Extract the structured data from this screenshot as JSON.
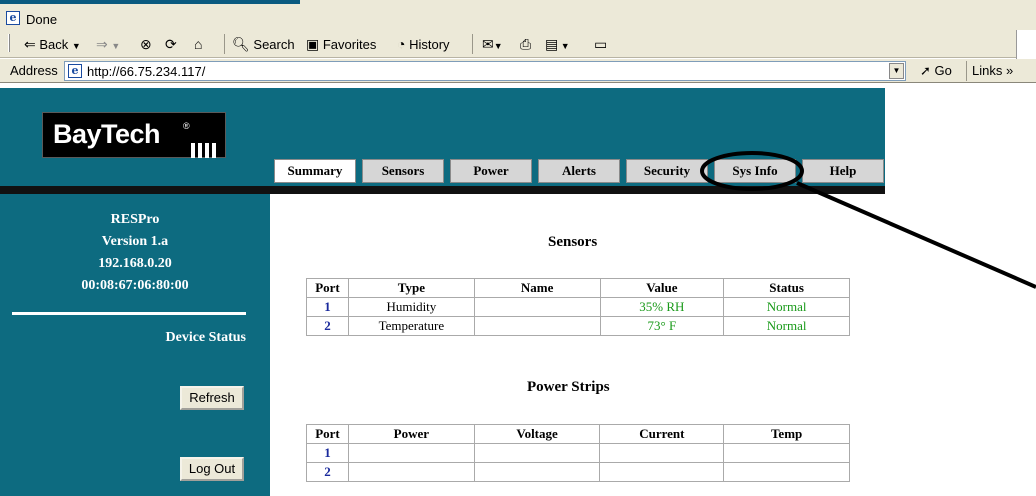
{
  "browser": {
    "status_text": "Done",
    "toolbar": {
      "back_label": "Back",
      "search_label": "Search",
      "favorites_label": "Favorites",
      "history_label": "History"
    },
    "address": {
      "label": "Address",
      "url": "http://66.75.234.117/",
      "go_label": "Go",
      "links_label": "Links »"
    }
  },
  "page": {
    "logo": {
      "brand": "BayTech",
      "mark": "®"
    },
    "tabs": [
      {
        "label": "Summary",
        "active": true
      },
      {
        "label": "Sensors"
      },
      {
        "label": "Power"
      },
      {
        "label": "Alerts"
      },
      {
        "label": "Security"
      },
      {
        "label": "Sys Info"
      },
      {
        "label": "Help"
      }
    ],
    "sidebar": {
      "product": "RESPro",
      "version": "Version 1.a",
      "ip": "192.168.0.20",
      "mac": "00:08:67:06:80:00",
      "device_status": "Device Status",
      "refresh_label": "Refresh",
      "logout_label": "Log Out"
    },
    "sensors": {
      "title": "Sensors",
      "headers": [
        "Port",
        "Type",
        "Name",
        "Value",
        "Status"
      ],
      "rows": [
        {
          "port": "1",
          "type": "Humidity",
          "name": "",
          "value": "35% RH",
          "status": "Normal"
        },
        {
          "port": "2",
          "type": "Temperature",
          "name": "",
          "value": "73° F",
          "status": "Normal"
        }
      ]
    },
    "power_strips": {
      "title": "Power Strips",
      "headers": [
        "Port",
        "Power",
        "Voltage",
        "Current",
        "Temp"
      ],
      "rows": [
        {
          "port": "1",
          "power": "",
          "voltage": "",
          "current": "",
          "temp": ""
        },
        {
          "port": "2",
          "power": "",
          "voltage": "",
          "current": "",
          "temp": ""
        }
      ]
    }
  },
  "colors": {
    "teal": "#0d6b80",
    "value_green": "#1a9a1a",
    "port_blue": "#1a2a9c"
  }
}
